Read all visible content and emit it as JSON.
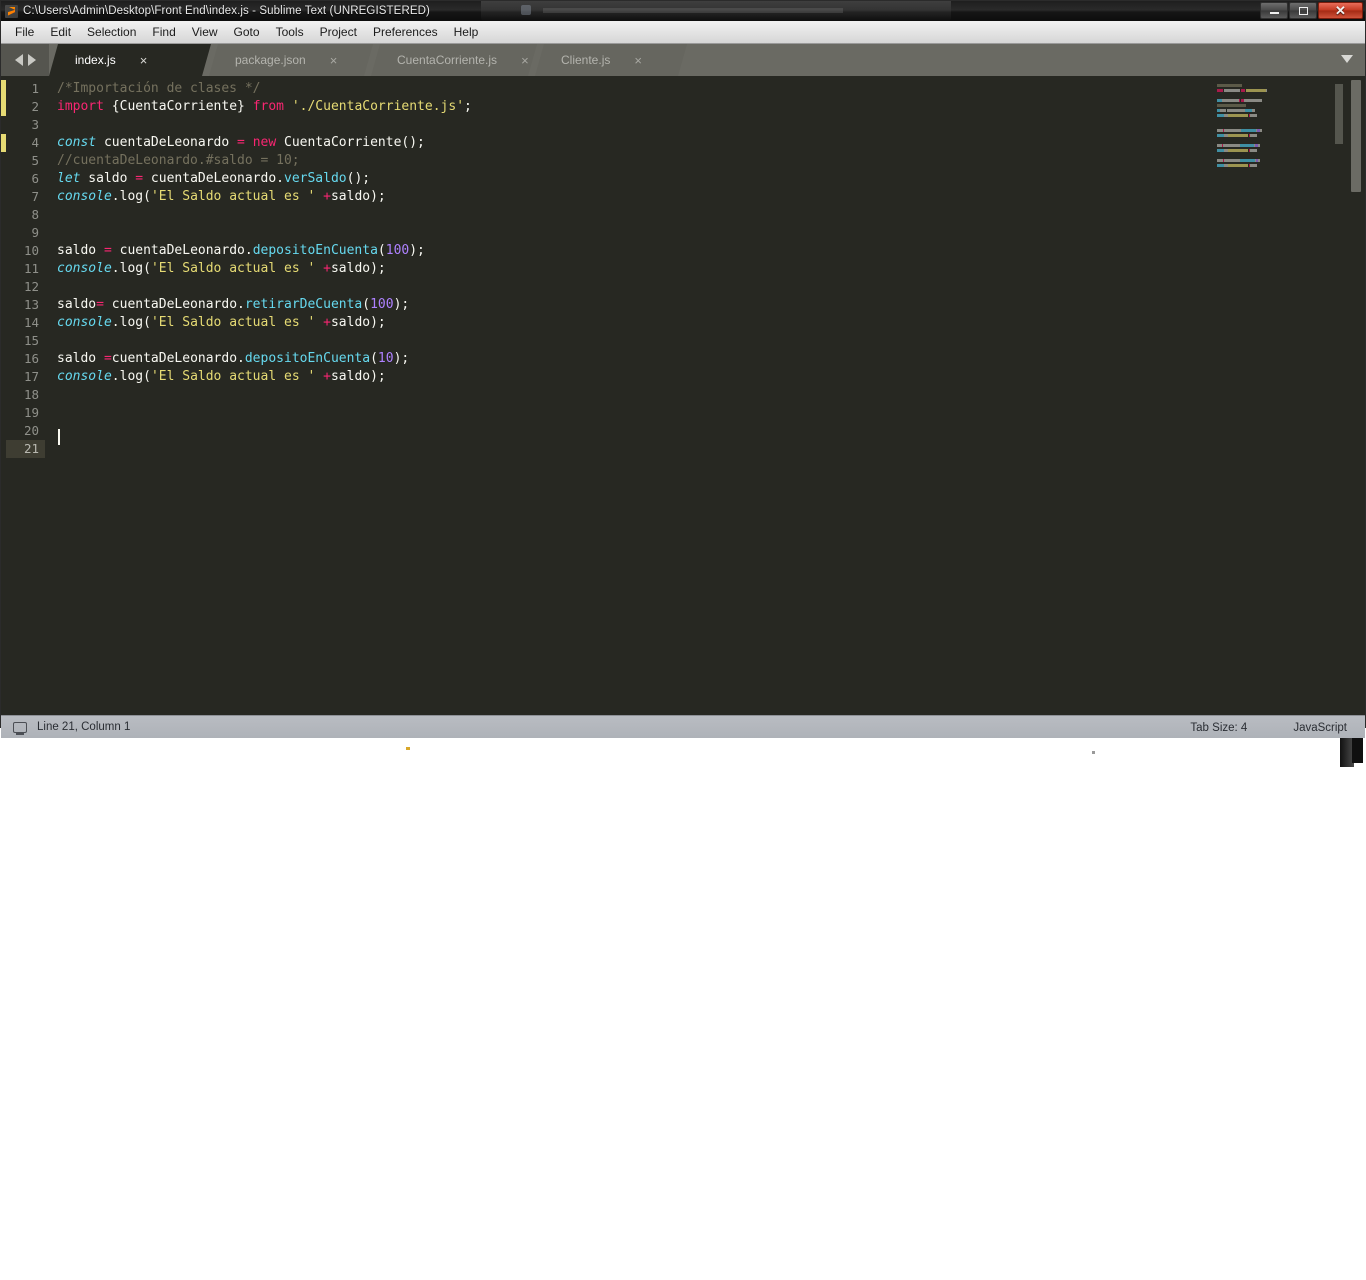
{
  "window": {
    "title": "C:\\Users\\Admin\\Desktop\\Front End\\index.js - Sublime Text (UNREGISTERED)",
    "app_icon": "sublime-text-logo-icon",
    "controls": {
      "minimize": "minimize-icon",
      "maximize": "restore-icon",
      "close": "close-icon"
    }
  },
  "menubar": {
    "items": [
      {
        "label": "File"
      },
      {
        "label": "Edit"
      },
      {
        "label": "Selection"
      },
      {
        "label": "Find"
      },
      {
        "label": "View"
      },
      {
        "label": "Goto"
      },
      {
        "label": "Tools"
      },
      {
        "label": "Project"
      },
      {
        "label": "Preferences"
      },
      {
        "label": "Help"
      }
    ]
  },
  "tabbar": {
    "prev_icon": "arrow-left-icon",
    "next_icon": "arrow-right-icon",
    "dropdown_icon": "chevron-down-icon",
    "close_glyph": "×",
    "tabs": [
      {
        "label": "index.js",
        "active": true
      },
      {
        "label": "package.json",
        "active": false
      },
      {
        "label": "CuentaCorriente.js",
        "active": false
      },
      {
        "label": "Cliente.js",
        "active": false
      }
    ]
  },
  "editor": {
    "line_numbers": [
      "1",
      "2",
      "3",
      "4",
      "5",
      "6",
      "7",
      "8",
      "9",
      "10",
      "11",
      "12",
      "13",
      "14",
      "15",
      "16",
      "17",
      "18",
      "19",
      "20",
      "21"
    ],
    "active_line": 21,
    "modified_line_ranges": [
      [
        1,
        2
      ],
      [
        4,
        4
      ]
    ],
    "lines": [
      {
        "n": 1,
        "tokens": [
          {
            "t": "/*Importación de clases */",
            "c": "c-com"
          }
        ]
      },
      {
        "n": 2,
        "tokens": [
          {
            "t": "import",
            "c": "c-kw"
          },
          {
            "t": " ",
            "c": "c-txt"
          },
          {
            "t": "{CuentaCorriente}",
            "c": "c-txt"
          },
          {
            "t": " ",
            "c": "c-txt"
          },
          {
            "t": "from",
            "c": "c-kw"
          },
          {
            "t": " ",
            "c": "c-txt"
          },
          {
            "t": "'./CuentaCorriente.js'",
            "c": "c-str"
          },
          {
            "t": ";",
            "c": "c-txt"
          }
        ]
      },
      {
        "n": 3,
        "tokens": []
      },
      {
        "n": 4,
        "tokens": [
          {
            "t": "const",
            "c": "c-it"
          },
          {
            "t": " cuentaDeLeonardo ",
            "c": "c-txt"
          },
          {
            "t": "=",
            "c": "c-kw"
          },
          {
            "t": " ",
            "c": "c-txt"
          },
          {
            "t": "new",
            "c": "c-kw"
          },
          {
            "t": " CuentaCorriente();",
            "c": "c-txt"
          }
        ]
      },
      {
        "n": 5,
        "tokens": [
          {
            "t": "//cuentaDeLeonardo.#saldo = 10;",
            "c": "c-com"
          }
        ]
      },
      {
        "n": 6,
        "tokens": [
          {
            "t": "let",
            "c": "c-it"
          },
          {
            "t": " saldo ",
            "c": "c-txt"
          },
          {
            "t": "=",
            "c": "c-kw"
          },
          {
            "t": " cuentaDeLeonardo.",
            "c": "c-txt"
          },
          {
            "t": "verSaldo",
            "c": "c-fn"
          },
          {
            "t": "();",
            "c": "c-txt"
          }
        ]
      },
      {
        "n": 7,
        "tokens": [
          {
            "t": "console",
            "c": "c-it"
          },
          {
            "t": ".log(",
            "c": "c-txt"
          },
          {
            "t": "'El Saldo actual es '",
            "c": "c-str"
          },
          {
            "t": " ",
            "c": "c-txt"
          },
          {
            "t": "+",
            "c": "c-kw"
          },
          {
            "t": "saldo);",
            "c": "c-txt"
          }
        ]
      },
      {
        "n": 8,
        "tokens": []
      },
      {
        "n": 9,
        "tokens": []
      },
      {
        "n": 10,
        "tokens": [
          {
            "t": "saldo ",
            "c": "c-txt"
          },
          {
            "t": "=",
            "c": "c-kw"
          },
          {
            "t": " cuentaDeLeonardo.",
            "c": "c-txt"
          },
          {
            "t": "depositoEnCuenta",
            "c": "c-fn"
          },
          {
            "t": "(",
            "c": "c-txt"
          },
          {
            "t": "100",
            "c": "c-num"
          },
          {
            "t": ");",
            "c": "c-txt"
          }
        ]
      },
      {
        "n": 11,
        "tokens": [
          {
            "t": "console",
            "c": "c-it"
          },
          {
            "t": ".log(",
            "c": "c-txt"
          },
          {
            "t": "'El Saldo actual es '",
            "c": "c-str"
          },
          {
            "t": " ",
            "c": "c-txt"
          },
          {
            "t": "+",
            "c": "c-kw"
          },
          {
            "t": "saldo);",
            "c": "c-txt"
          }
        ]
      },
      {
        "n": 12,
        "tokens": []
      },
      {
        "n": 13,
        "tokens": [
          {
            "t": "saldo",
            "c": "c-txt"
          },
          {
            "t": "=",
            "c": "c-kw"
          },
          {
            "t": " cuentaDeLeonardo.",
            "c": "c-txt"
          },
          {
            "t": "retirarDeCuenta",
            "c": "c-fn"
          },
          {
            "t": "(",
            "c": "c-txt"
          },
          {
            "t": "100",
            "c": "c-num"
          },
          {
            "t": ");",
            "c": "c-txt"
          }
        ]
      },
      {
        "n": 14,
        "tokens": [
          {
            "t": "console",
            "c": "c-it"
          },
          {
            "t": ".log(",
            "c": "c-txt"
          },
          {
            "t": "'El Saldo actual es '",
            "c": "c-str"
          },
          {
            "t": " ",
            "c": "c-txt"
          },
          {
            "t": "+",
            "c": "c-kw"
          },
          {
            "t": "saldo);",
            "c": "c-txt"
          }
        ]
      },
      {
        "n": 15,
        "tokens": []
      },
      {
        "n": 16,
        "tokens": [
          {
            "t": "saldo ",
            "c": "c-txt"
          },
          {
            "t": "=",
            "c": "c-kw"
          },
          {
            "t": "cuentaDeLeonardo.",
            "c": "c-txt"
          },
          {
            "t": "depositoEnCuenta",
            "c": "c-fn"
          },
          {
            "t": "(",
            "c": "c-txt"
          },
          {
            "t": "10",
            "c": "c-num"
          },
          {
            "t": ");",
            "c": "c-txt"
          }
        ]
      },
      {
        "n": 17,
        "tokens": [
          {
            "t": "console",
            "c": "c-it"
          },
          {
            "t": ".log(",
            "c": "c-txt"
          },
          {
            "t": "'El Saldo actual es '",
            "c": "c-str"
          },
          {
            "t": " ",
            "c": "c-txt"
          },
          {
            "t": "+",
            "c": "c-kw"
          },
          {
            "t": "saldo);",
            "c": "c-txt"
          }
        ]
      },
      {
        "n": 18,
        "tokens": []
      },
      {
        "n": 19,
        "tokens": []
      },
      {
        "n": 20,
        "tokens": []
      },
      {
        "n": 21,
        "tokens": []
      }
    ]
  },
  "statusbar": {
    "monitor_icon": "monitor-icon",
    "position": "Line 21, Column 1",
    "tab_size": "Tab Size: 4",
    "syntax": "JavaScript"
  },
  "colors": {
    "editor_bg": "#272822",
    "keyword": "#f92672",
    "string": "#e6db74",
    "function": "#66d9ef",
    "number": "#ae81ff",
    "comment": "#75715e",
    "text": "#f8f8f2",
    "modified_marker": "#e6db74",
    "tabbar_bg": "#6a6a63",
    "statusbar_bg": "#b4b7bd",
    "close_button": "#c43a22"
  }
}
